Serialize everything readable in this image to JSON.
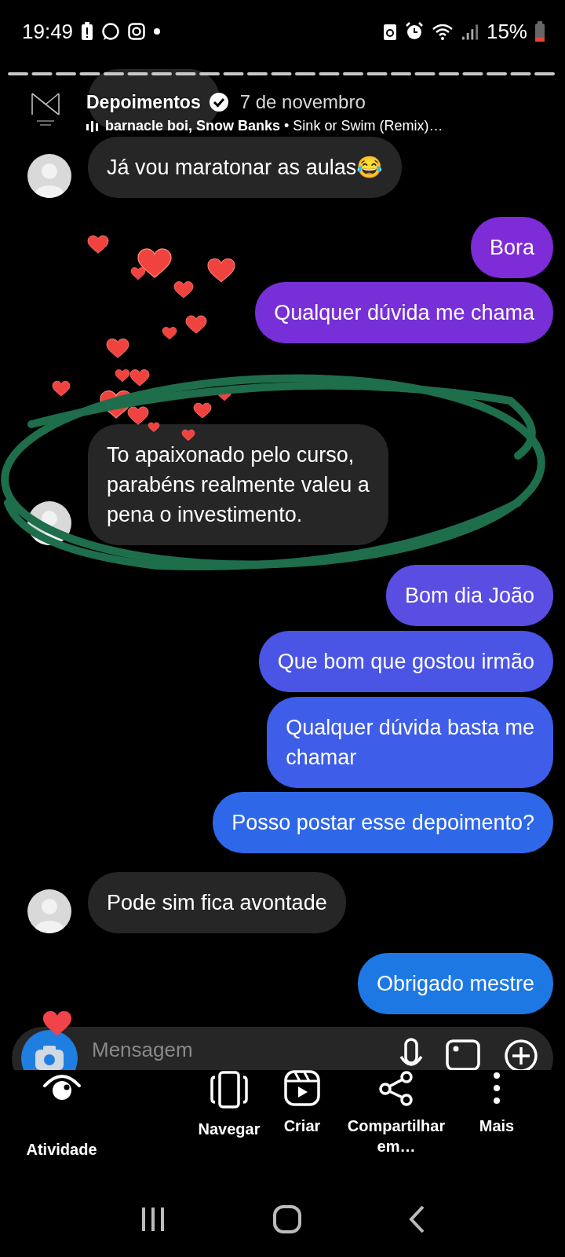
{
  "status_bar": {
    "time": "19:49",
    "battery": "15%"
  },
  "story": {
    "account": "Depoimentos",
    "verified": true,
    "date": "7 de novembro",
    "music": "**barnacle boi, Snow Banks** • Sink or Swim (Remix)…"
  },
  "messages": [
    {
      "kind": "covered"
    },
    {
      "kind": "incoming",
      "text": "Já vou maratonar as aulas😂",
      "avatar": true
    },
    {
      "kind": "outgoing",
      "text": "Bora",
      "color": "#7e2bd8"
    },
    {
      "kind": "outgoing",
      "text": "Qualquer dúvida me chama",
      "color": "#772fd8"
    },
    {
      "kind": "incoming",
      "text": "To apaixonado pelo curso,\nparabéns realmente valeu a\npena o investimento.",
      "avatar": true
    },
    {
      "kind": "outgoing",
      "text": "Bom dia João",
      "color": "#5a4de2"
    },
    {
      "kind": "outgoing",
      "text": "Que bom que gostou irmão",
      "color": "#4a55e6"
    },
    {
      "kind": "outgoing",
      "text": "Qualquer dúvida basta me\nchamar",
      "color": "#3e5de8"
    },
    {
      "kind": "outgoing",
      "text": "Posso postar esse depoimento?",
      "color": "#2e68e8"
    },
    {
      "kind": "incoming",
      "text": "Pode sim fica avontade",
      "avatar": true
    },
    {
      "kind": "outgoing",
      "text": "Obrigado mestre",
      "color": "#1d78e4"
    }
  ],
  "composer": {
    "placeholder": "Mensagem"
  },
  "activity": {
    "label": "Atividade"
  },
  "actions": [
    {
      "kind": "browse",
      "label": "Navegar"
    },
    {
      "kind": "create",
      "label": "Criar"
    },
    {
      "kind": "share",
      "label": "Compartilhar em…"
    },
    {
      "kind": "more",
      "label": "Mais"
    }
  ]
}
